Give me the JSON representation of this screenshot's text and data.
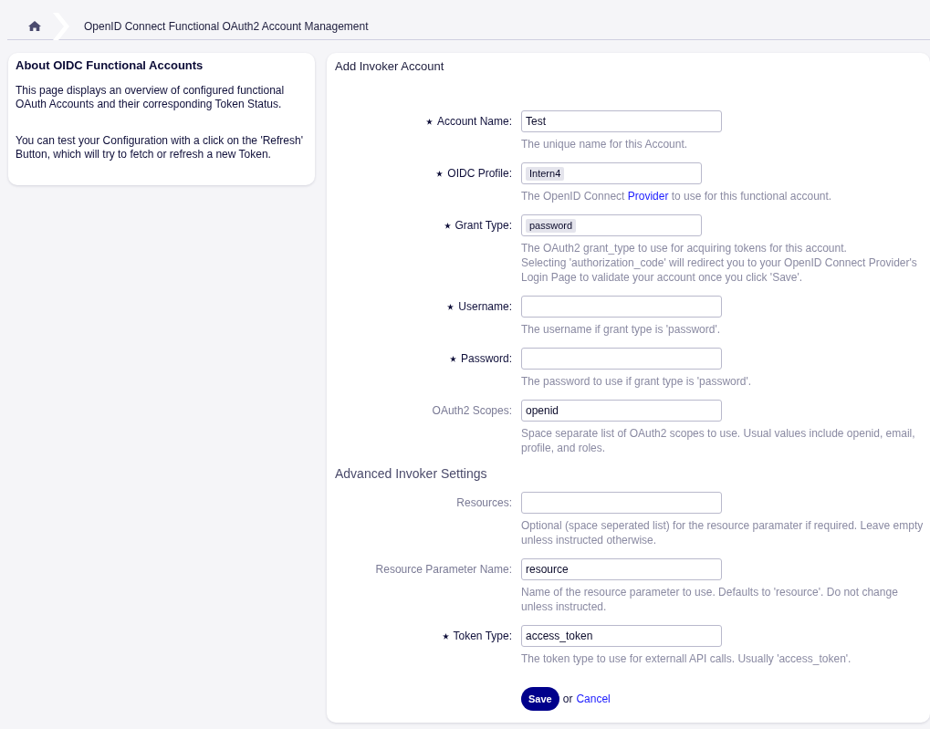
{
  "breadcrumb": {
    "title": "OpenID Connect Functional OAuth2 Account Management"
  },
  "sidebar": {
    "title": "About OIDC Functional Accounts",
    "paragraphs": [
      "This page displays an overview of configured functional OAuth Accounts and their corresponding Token Status.",
      "You can test your Configuration with a click on the 'Refresh' Button, which will try to fetch or refresh a new Token."
    ]
  },
  "form": {
    "title": "Add Invoker Account",
    "sections": [
      {
        "fields": [
          {
            "label": "Account Name:",
            "required": true,
            "kind": "text",
            "value": "Test",
            "hint": [
              "The unique name for this Account."
            ]
          },
          {
            "label": "OIDC Profile:",
            "required": true,
            "kind": "select",
            "value": "Intern4",
            "hint": [
              {
                "before": "The OpenID Connect",
                "link": "Provider",
                "after": "to use for this functional account."
              }
            ]
          },
          {
            "label": "Grant Type:",
            "required": true,
            "kind": "select",
            "value": "password",
            "hint": [
              "The OAuth2 grant_type to use for acquiring tokens for this account.",
              "Selecting 'authorization_code' will redirect you to your OpenID Connect Provider's Login Page to validate your account once you click 'Save'."
            ]
          },
          {
            "label": "Username:",
            "required": true,
            "kind": "text",
            "hint": [
              "The username if grant type is 'password'."
            ]
          },
          {
            "label": "Password:",
            "required": true,
            "kind": "text",
            "hint": [
              "The password to use if grant type is 'password'."
            ]
          },
          {
            "label": "OAuth2 Scopes:",
            "required": false,
            "kind": "text",
            "value": "openid",
            "hint": [
              "Space separate list of OAuth2 scopes to use. Usual values include openid, email, profile, and roles."
            ]
          }
        ]
      },
      {
        "title": "Advanced Invoker Settings",
        "fields": [
          {
            "label": "Resources:",
            "required": false,
            "kind": "text",
            "hint": [
              "Optional (space seperated list) for the resource paramater if required. Leave empty unless instructed otherwise."
            ]
          },
          {
            "label": "Resource Parameter Name:",
            "required": false,
            "kind": "text",
            "value": "resource",
            "hint": [
              "Name of the resource parameter to use. Defaults to 'resource'. Do not change unless instructed."
            ]
          },
          {
            "label": "Token Type:",
            "required": true,
            "kind": "text",
            "value": "access_token",
            "hint": [
              "The token type to use for externall API calls. Usually 'access_token'."
            ]
          }
        ]
      }
    ],
    "actions": {
      "save": "Save",
      "separator": "or",
      "cancel": "Cancel"
    }
  }
}
